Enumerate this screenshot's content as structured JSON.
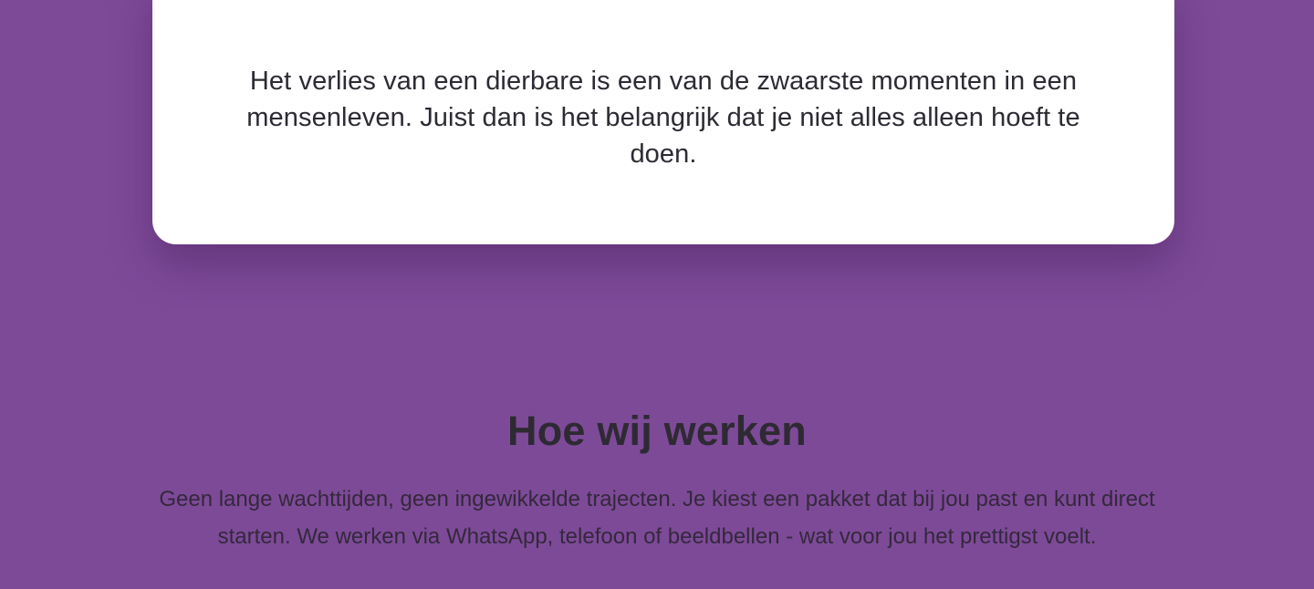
{
  "intro": {
    "text": "Het verlies van een dierbare is een van de zwaarste momenten in een mensenleven. Juist dan is het belangrijk dat je niet alles alleen hoeft te doen."
  },
  "how_we_work": {
    "title": "Hoe wij werken",
    "body": "Geen lange wachttijden, geen ingewikkelde trajecten. Je kiest een pakket dat bij jou past en kunt direct starten. We werken via WhatsApp, telefoon of beeldbellen - wat voor jou het prettigst voelt."
  },
  "colors": {
    "page_background": "#7d4a98",
    "card_background": "#ffffff",
    "text_dark": "#2b2b33"
  }
}
